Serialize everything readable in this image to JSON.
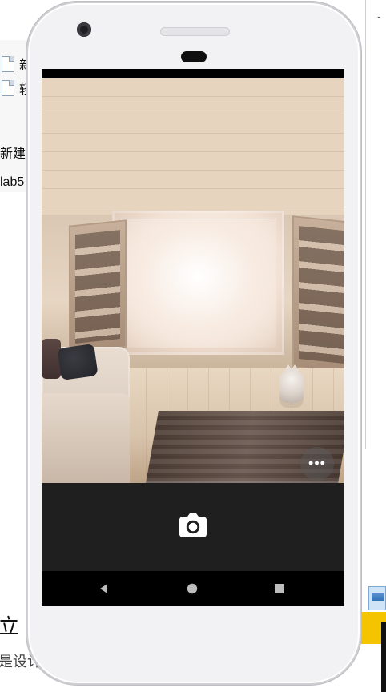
{
  "background": {
    "explorer": {
      "items": [
        {
          "label": "新"
        },
        {
          "label": "轻"
        },
        {
          "label": "新建"
        },
        {
          "label": "lab5"
        }
      ]
    },
    "right_panel": {
      "minimize": "-"
    },
    "bottom_left": {
      "line1": "立",
      "line2": "是设计"
    }
  },
  "phone": {
    "app": {
      "camera_view": {
        "more_button": {
          "icon": "more-horizontal-icon"
        },
        "capture_button": {
          "icon": "camera-icon"
        }
      }
    },
    "nav_bar": {
      "back": {
        "icon": "back-triangle-icon"
      },
      "home": {
        "icon": "home-circle-icon"
      },
      "recents": {
        "icon": "recents-square-icon"
      }
    }
  }
}
